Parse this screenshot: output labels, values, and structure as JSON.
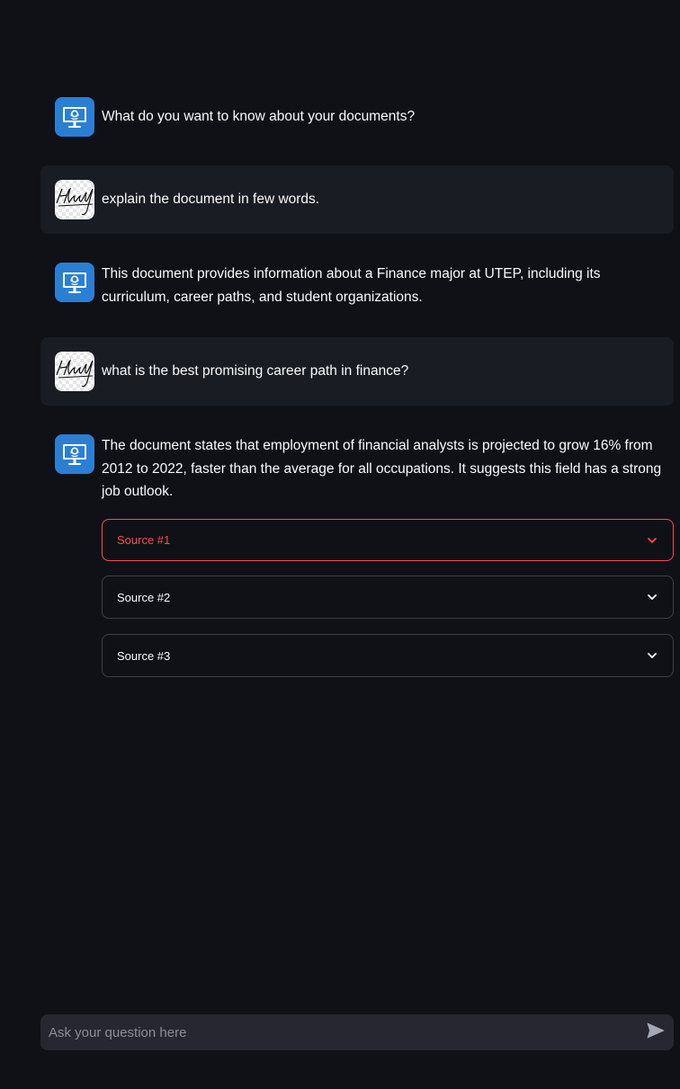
{
  "messages": [
    {
      "role": "assistant",
      "avatar": "support-agent-icon",
      "text": "What do you want to know about your documents?"
    },
    {
      "role": "user",
      "avatar": "user-signature-avatar",
      "text": "explain the document in few words."
    },
    {
      "role": "assistant",
      "avatar": "support-agent-icon",
      "text": "This document provides information about a Finance major at UTEP, including its curriculum, career paths, and student organizations."
    },
    {
      "role": "user",
      "avatar": "user-signature-avatar",
      "text": "what is the best promising career path in finance?"
    },
    {
      "role": "assistant",
      "avatar": "support-agent-icon",
      "text": "The document states that employment of financial analysts is projected to grow 16% from 2012 to 2022, faster than the average for all occupations. It suggests this field has a strong job outlook."
    }
  ],
  "sources": [
    {
      "label": "Source #1",
      "expanded": false,
      "focused": true
    },
    {
      "label": "Source #2",
      "expanded": false,
      "focused": false
    },
    {
      "label": "Source #3",
      "expanded": false,
      "focused": false
    }
  ],
  "chat_input": {
    "placeholder": "Ask your question here",
    "value": ""
  },
  "colors": {
    "background": "#0f1117",
    "user_bubble": "#1a1c24",
    "focus_accent": "#ff4b4b",
    "input_bg": "#262730",
    "bot_avatar": "#2b7fd3"
  }
}
